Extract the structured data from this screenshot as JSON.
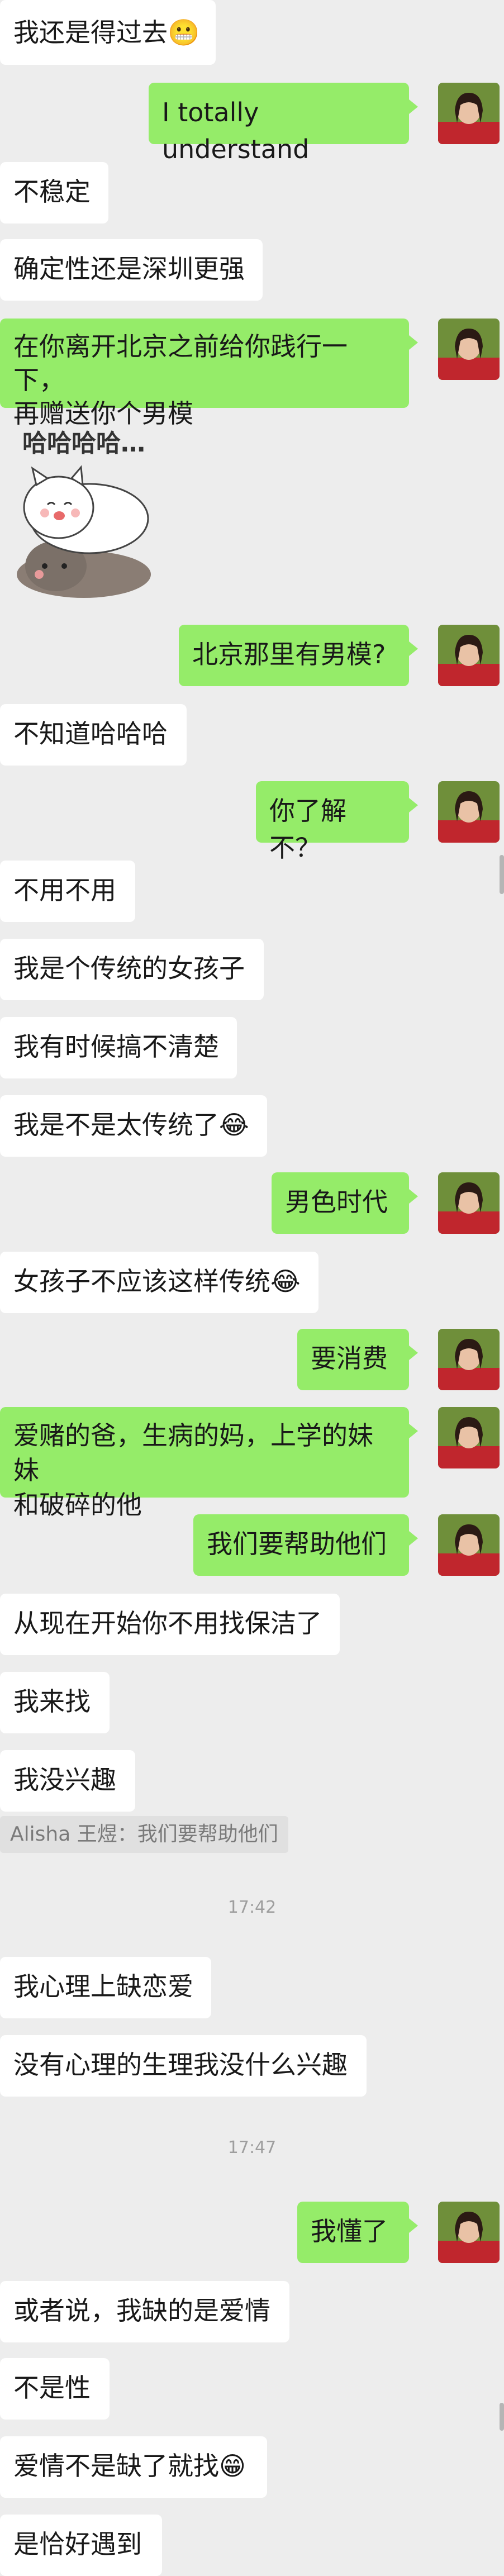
{
  "messages": [
    {
      "text": "我还是得过去😬"
    },
    {
      "text": "I totally understand"
    },
    {
      "text": "不稳定"
    },
    {
      "text": "确定性还是深圳更强"
    },
    {
      "text": "在你离开北京之前给你践行一下，\n再赠送你个男模"
    },
    {
      "sticker_text": "哈哈哈哈…"
    },
    {
      "text": "北京那里有男模?"
    },
    {
      "text": "不知道哈哈哈"
    },
    {
      "text": "你了解不？"
    },
    {
      "text": "不用不用"
    },
    {
      "text": "我是个传统的女孩子"
    },
    {
      "text": "我有时候搞不清楚"
    },
    {
      "text": "我是不是太传统了😂"
    },
    {
      "text": "男色时代"
    },
    {
      "text": "女孩子不应该这样传统😂"
    },
    {
      "text": "要消费"
    },
    {
      "text": "爱赌的爸，生病的妈，上学的妹妹\n和破碎的他"
    },
    {
      "text": "我们要帮助他们"
    },
    {
      "text": "从现在开始你不用找保洁了"
    },
    {
      "text": "我来找"
    },
    {
      "text": "我没兴趣"
    },
    {
      "quote": "Alisha 王煜：我们要帮助他们"
    },
    {
      "time": "17:42"
    },
    {
      "text": "我心理上缺恋爱"
    },
    {
      "text": "没有心理的生理我没什么兴趣"
    },
    {
      "time": "17:47"
    },
    {
      "text": "我懂了"
    },
    {
      "text": "或者说，我缺的是爱情"
    },
    {
      "text": "不是性"
    },
    {
      "text": "爱情不是缺了就找😁"
    },
    {
      "text": "是恰好遇到"
    }
  ],
  "colors": {
    "background": "#ededed",
    "incoming": "#ffffff",
    "outgoing": "#95ec69"
  },
  "icons": {
    "avatar": "user-avatar-icon",
    "sticker": "cat-sticker-icon"
  }
}
